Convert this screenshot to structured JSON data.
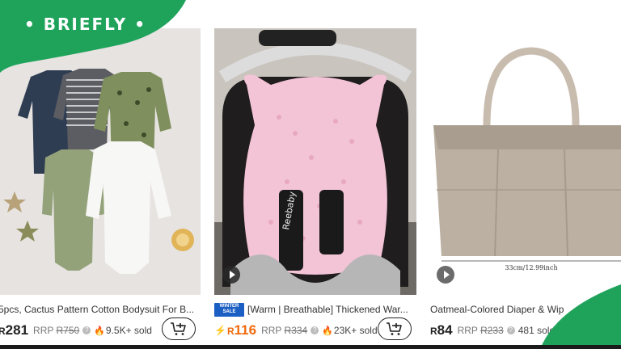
{
  "brand": {
    "logo_text": "• BRIEFLY •",
    "color": "#1fa35b"
  },
  "products": [
    {
      "title": "5pcs, Cactus Pattern Cotton Bodysuit For B...",
      "currency": "R",
      "price": "281",
      "rrp_label": "RRP",
      "rrp_value": "R750",
      "sold": "9.5K+ sold",
      "image_icon": "baby-bodysuits-image"
    },
    {
      "badge_line1": "WINTER",
      "badge_line2": "SALE",
      "title": "[Warm | Breathable] Thickened War...",
      "currency": "R",
      "price": "116",
      "rrp_label": "RRP",
      "rrp_value": "R334",
      "sold": "23K+ sold",
      "seat_brand": "Reebaby",
      "image_icon": "car-seat-insert-image"
    },
    {
      "title": "Oatmeal-Colored Diaper & Wip",
      "currency": "R",
      "price": "84",
      "rrp_label": "RRP",
      "rrp_value": "R233",
      "sold": "481 sold",
      "dimension": "33cm/12.99inch",
      "image_icon": "felt-diaper-caddy-image"
    }
  ],
  "accent_orange": "#f06a0c"
}
